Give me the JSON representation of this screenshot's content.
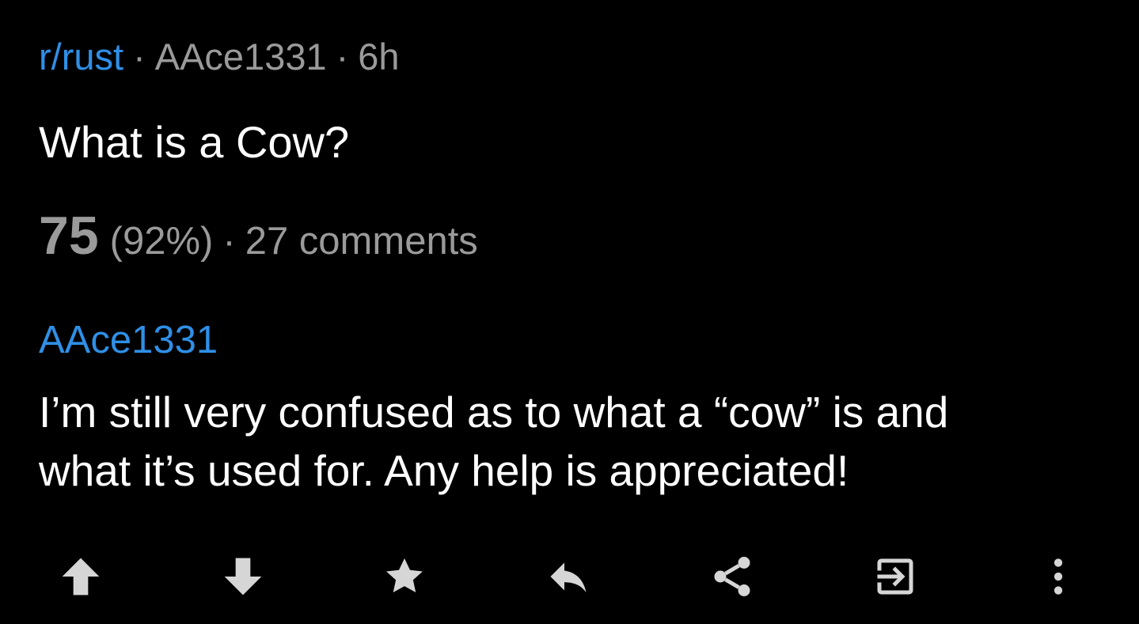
{
  "post": {
    "subreddit": "r/rust",
    "separator": "·",
    "author": "AAce1331",
    "age": "6h",
    "title": "What is a Cow?",
    "score": "75",
    "upvote_ratio": "(92%)",
    "comments": "27 comments"
  },
  "selftext": {
    "author": "AAce1331",
    "lines": [
      "I’m still very confused as to what a “cow” is and",
      "what it’s used for. Any help is appreciated!"
    ]
  },
  "actions": [
    {
      "icon": "upvote-icon"
    },
    {
      "icon": "downvote-icon"
    },
    {
      "icon": "star-icon"
    },
    {
      "icon": "reply-icon"
    },
    {
      "icon": "share-icon"
    },
    {
      "icon": "open-external-icon"
    },
    {
      "icon": "more-vertical-icon"
    }
  ],
  "colors": {
    "background": "#000000",
    "link_blue": "#2f8fe6",
    "muted_gray": "#9a9a9a",
    "text_white": "#ffffff",
    "icon_gray": "#cfcfcf"
  }
}
